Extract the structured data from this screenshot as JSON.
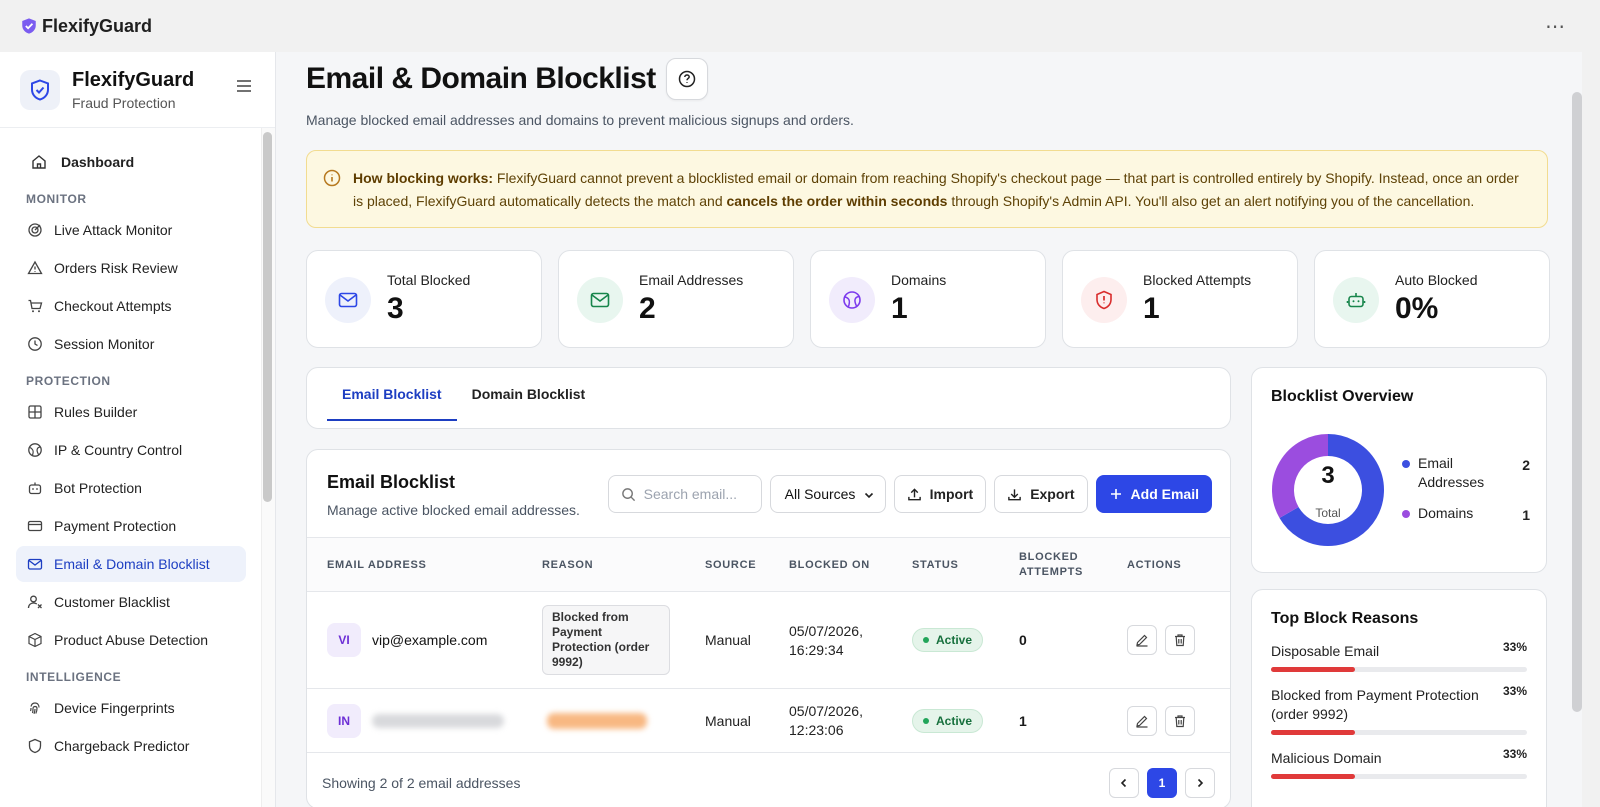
{
  "app": {
    "name": "FlexifyGuard",
    "more": "⋯"
  },
  "sidebar": {
    "title": "FlexifyGuard",
    "subtitle": "Fraud Protection",
    "dashboard": "Dashboard",
    "sections": [
      {
        "label": "MONITOR",
        "items": [
          "Live Attack Monitor",
          "Orders Risk Review",
          "Checkout Attempts",
          "Session Monitor"
        ]
      },
      {
        "label": "PROTECTION",
        "items": [
          "Rules Builder",
          "IP & Country Control",
          "Bot Protection",
          "Payment Protection",
          "Email & Domain Blocklist",
          "Customer Blacklist",
          "Product Abuse Detection"
        ]
      },
      {
        "label": "INTELLIGENCE",
        "items": [
          "Device Fingerprints",
          "Chargeback Predictor"
        ]
      }
    ],
    "active": "Email & Domain Blocklist"
  },
  "page": {
    "title": "Email & Domain Blocklist",
    "subtitle": "Manage blocked email addresses and domains to prevent malicious signups and orders."
  },
  "alert": {
    "lead": "How blocking works:",
    "text1": " FlexifyGuard cannot prevent a blocklisted email or domain from reaching Shopify's checkout page — that part is controlled entirely by Shopify. Instead, once an order is placed, FlexifyGuard automatically detects the match and ",
    "bold2": "cancels the order within seconds",
    "text2": " through Shopify's Admin API. You'll also get an alert notifying you of the cancellation."
  },
  "stats": [
    {
      "label": "Total Blocked",
      "value": "3"
    },
    {
      "label": "Email Addresses",
      "value": "2"
    },
    {
      "label": "Domains",
      "value": "1"
    },
    {
      "label": "Blocked Attempts",
      "value": "1"
    },
    {
      "label": "Auto Blocked",
      "value": "0%"
    }
  ],
  "tabs": [
    "Email Blocklist",
    "Domain Blocklist"
  ],
  "table": {
    "title": "Email Blocklist",
    "subtitle": "Manage active blocked email addresses.",
    "search_placeholder": "Search email...",
    "source_filter": "All Sources",
    "import_label": "Import",
    "export_label": "Export",
    "add_label": "Add Email",
    "columns": [
      "EMAIL ADDRESS",
      "REASON",
      "SOURCE",
      "BLOCKED ON",
      "STATUS",
      "BLOCKED",
      "ATTEMPTS",
      "ACTIONS"
    ],
    "rows": [
      {
        "initials": "VI",
        "email": "vip@example.com",
        "reason": "Blocked from Payment Protection (order 9992)",
        "source": "Manual",
        "date": "05/07/2026,",
        "time": "16:29:34",
        "status": "Active",
        "attempts": "0"
      },
      {
        "initials": "IN",
        "email": "",
        "reason": "",
        "source": "Manual",
        "date": "05/07/2026,",
        "time": "12:23:06",
        "status": "Active",
        "attempts": "1"
      }
    ],
    "footer": "Showing 2 of 2 email addresses",
    "page": "1"
  },
  "overview": {
    "title": "Blocklist Overview",
    "total": "3",
    "total_label": "Total",
    "legend": [
      {
        "name": "Email Addresses",
        "value": "2",
        "count": 2,
        "color": "#3c4fe0"
      },
      {
        "name": "Domains",
        "value": "1",
        "count": 1,
        "color": "#9b4ddf"
      }
    ]
  },
  "reasons": {
    "title": "Top Block Reasons",
    "items": [
      {
        "label": "Disposable Email",
        "pct": "33%",
        "frac": 0.33
      },
      {
        "label": "Blocked from Payment Protection (order 9992)",
        "pct": "33%",
        "frac": 0.33
      },
      {
        "label": "Malicious Domain",
        "pct": "33%",
        "frac": 0.33
      }
    ]
  }
}
